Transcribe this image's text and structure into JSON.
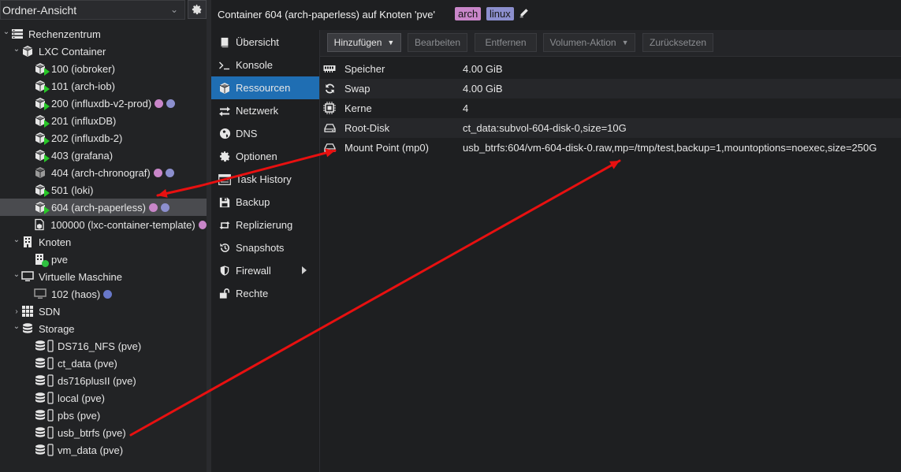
{
  "sidebar": {
    "view_selector": "Ordner-Ansicht",
    "tree": [
      {
        "label": "Rechenzentrum",
        "icon": "datacenter-icon",
        "indent": 0,
        "toggle": "expanded"
      },
      {
        "label": "LXC Container",
        "icon": "cube-icon",
        "indent": 1,
        "toggle": "expanded"
      },
      {
        "label": "100 (iobroker)",
        "icon": "container-running-icon",
        "indent": 2,
        "toggle": "none",
        "tags": []
      },
      {
        "label": "101 (arch-iob)",
        "icon": "container-running-icon",
        "indent": 2,
        "toggle": "none",
        "tags": []
      },
      {
        "label": "200 (influxdb-v2-prod)",
        "icon": "container-running-icon",
        "indent": 2,
        "toggle": "none",
        "tags": [
          "pink",
          "lav"
        ]
      },
      {
        "label": "201 (influxDB)",
        "icon": "container-running-icon",
        "indent": 2,
        "toggle": "none",
        "tags": []
      },
      {
        "label": "202 (influxdb-2)",
        "icon": "container-running-icon",
        "indent": 2,
        "toggle": "none",
        "tags": []
      },
      {
        "label": "403 (grafana)",
        "icon": "container-running-icon",
        "indent": 2,
        "toggle": "none",
        "tags": []
      },
      {
        "label": "404 (arch-chronograf)",
        "icon": "container-stopped-icon",
        "indent": 2,
        "toggle": "none",
        "tags": [
          "pink",
          "lav"
        ]
      },
      {
        "label": "501 (loki)",
        "icon": "container-running-icon",
        "indent": 2,
        "toggle": "none",
        "tags": []
      },
      {
        "label": "604 (arch-paperless)",
        "icon": "container-running-icon",
        "indent": 2,
        "toggle": "none",
        "tags": [
          "pink",
          "lav"
        ],
        "selected": true
      },
      {
        "label": "100000 (lxc-container-template)",
        "icon": "template-icon",
        "indent": 2,
        "toggle": "none",
        "tags": [
          "pink"
        ]
      },
      {
        "label": "Knoten",
        "icon": "building-icon",
        "indent": 1,
        "toggle": "expanded"
      },
      {
        "label": "pve",
        "icon": "node-online-icon",
        "indent": 2,
        "toggle": "none",
        "tags": []
      },
      {
        "label": "Virtuelle Maschine",
        "icon": "monitor-icon",
        "indent": 1,
        "toggle": "expanded"
      },
      {
        "label": "102 (haos)",
        "icon": "vm-icon",
        "indent": 2,
        "toggle": "none",
        "tags": [
          "blue"
        ]
      },
      {
        "label": "SDN",
        "icon": "grid-icon",
        "indent": 1,
        "toggle": "collapsed"
      },
      {
        "label": "Storage",
        "icon": "database-icon",
        "indent": 1,
        "toggle": "expanded"
      },
      {
        "label": "DS716_NFS (pve)",
        "icon": "storage-icon",
        "indent": 2,
        "toggle": "none",
        "tags": []
      },
      {
        "label": "ct_data (pve)",
        "icon": "storage-icon",
        "indent": 2,
        "toggle": "none",
        "tags": []
      },
      {
        "label": "ds716plusII (pve)",
        "icon": "storage-icon",
        "indent": 2,
        "toggle": "none",
        "tags": []
      },
      {
        "label": "local (pve)",
        "icon": "storage-icon",
        "indent": 2,
        "toggle": "none",
        "tags": []
      },
      {
        "label": "pbs (pve)",
        "icon": "storage-icon",
        "indent": 2,
        "toggle": "none",
        "tags": []
      },
      {
        "label": "usb_btrfs (pve)",
        "icon": "storage-icon",
        "indent": 2,
        "toggle": "none",
        "tags": []
      },
      {
        "label": "vm_data (pve)",
        "icon": "storage-icon",
        "indent": 2,
        "toggle": "none",
        "tags": []
      }
    ]
  },
  "header": {
    "title": "Container 604 (arch-paperless) auf Knoten 'pve'",
    "tags": [
      {
        "label": "arch",
        "color": "#c986c9"
      },
      {
        "label": "linux",
        "color": "#8c8fce"
      }
    ]
  },
  "nav": [
    {
      "label": "Übersicht",
      "icon": "book-icon"
    },
    {
      "label": "Konsole",
      "icon": "terminal-icon"
    },
    {
      "label": "Ressourcen",
      "icon": "cube-icon",
      "active": true
    },
    {
      "label": "Netzwerk",
      "icon": "exchange-icon"
    },
    {
      "label": "DNS",
      "icon": "globe-icon"
    },
    {
      "label": "Optionen",
      "icon": "gear-icon"
    },
    {
      "label": "Task History",
      "icon": "list-icon"
    },
    {
      "label": "Backup",
      "icon": "floppy-icon"
    },
    {
      "label": "Replizierung",
      "icon": "retweet-icon"
    },
    {
      "label": "Snapshots",
      "icon": "history-icon"
    },
    {
      "label": "Firewall",
      "icon": "shield-icon",
      "submenu": true
    },
    {
      "label": "Rechte",
      "icon": "unlock-icon"
    }
  ],
  "toolbar": {
    "add": "Hinzufügen",
    "edit": "Bearbeiten",
    "remove": "Entfernen",
    "volume_action": "Volumen-Aktion",
    "reset": "Zurücksetzen"
  },
  "resources": [
    {
      "key": "Speicher",
      "value": "4.00 GiB",
      "icon": "memory-icon"
    },
    {
      "key": "Swap",
      "value": "4.00 GiB",
      "icon": "refresh-icon"
    },
    {
      "key": "Kerne",
      "value": "4",
      "icon": "cpu-icon"
    },
    {
      "key": "Root-Disk",
      "value": "ct_data:subvol-604-disk-0,size=10G",
      "icon": "hdd-icon"
    },
    {
      "key": "Mount Point (mp0)",
      "value": "usb_btrfs:604/vm-604-disk-0.raw,mp=/tmp/test,backup=1,mountoptions=noexec,size=250G",
      "icon": "hdd-icon"
    }
  ],
  "annotation": {
    "arrow_color": "#e81010"
  }
}
